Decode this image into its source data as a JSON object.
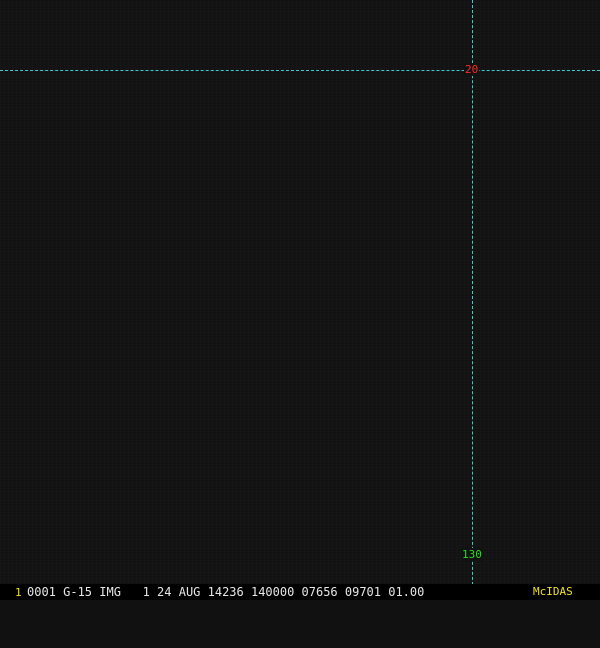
{
  "display": {
    "background_color": "#121212",
    "grid_color": "#3fc8cf"
  },
  "grid": {
    "latitude_label": "20",
    "latitude_color": "#ff2a2a",
    "longitude_label": "130",
    "longitude_color": "#22dd22"
  },
  "status_bar": {
    "frame_number": "1",
    "frame_number_color": "#f0e020",
    "frame_info": "0001 G-15 IMG   1 24 AUG 14236 140000 07656 09701 01.00",
    "vendor": "McIDAS",
    "vendor_color": "#f0e020"
  }
}
